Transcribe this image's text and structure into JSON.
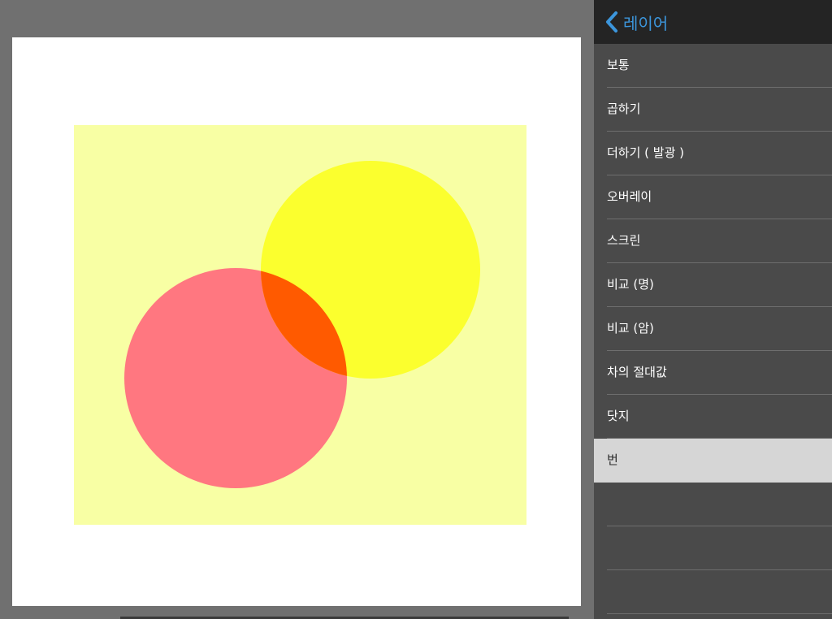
{
  "panel": {
    "title": "레이어",
    "back_icon": "chevron-left-icon",
    "accent_color": "#3c96dc",
    "items": [
      {
        "label": "보통"
      },
      {
        "label": "곱하기"
      },
      {
        "label": "더하기 ( 발광 )"
      },
      {
        "label": "오버레이"
      },
      {
        "label": "스크린"
      },
      {
        "label": "비교 (명)"
      },
      {
        "label": "비교 (암)"
      },
      {
        "label": "차의 절대값"
      },
      {
        "label": "닷지"
      },
      {
        "label": "번",
        "selected": true
      },
      {
        "label": ""
      },
      {
        "label": ""
      },
      {
        "label": ""
      }
    ]
  },
  "canvas": {
    "background_color": "#ffffff",
    "layer_color": "#f8ffa4",
    "red_circle_color": "#ff7780",
    "yellow_circle_color": "#fbff2e",
    "overlap_color": "#ff5a00"
  }
}
